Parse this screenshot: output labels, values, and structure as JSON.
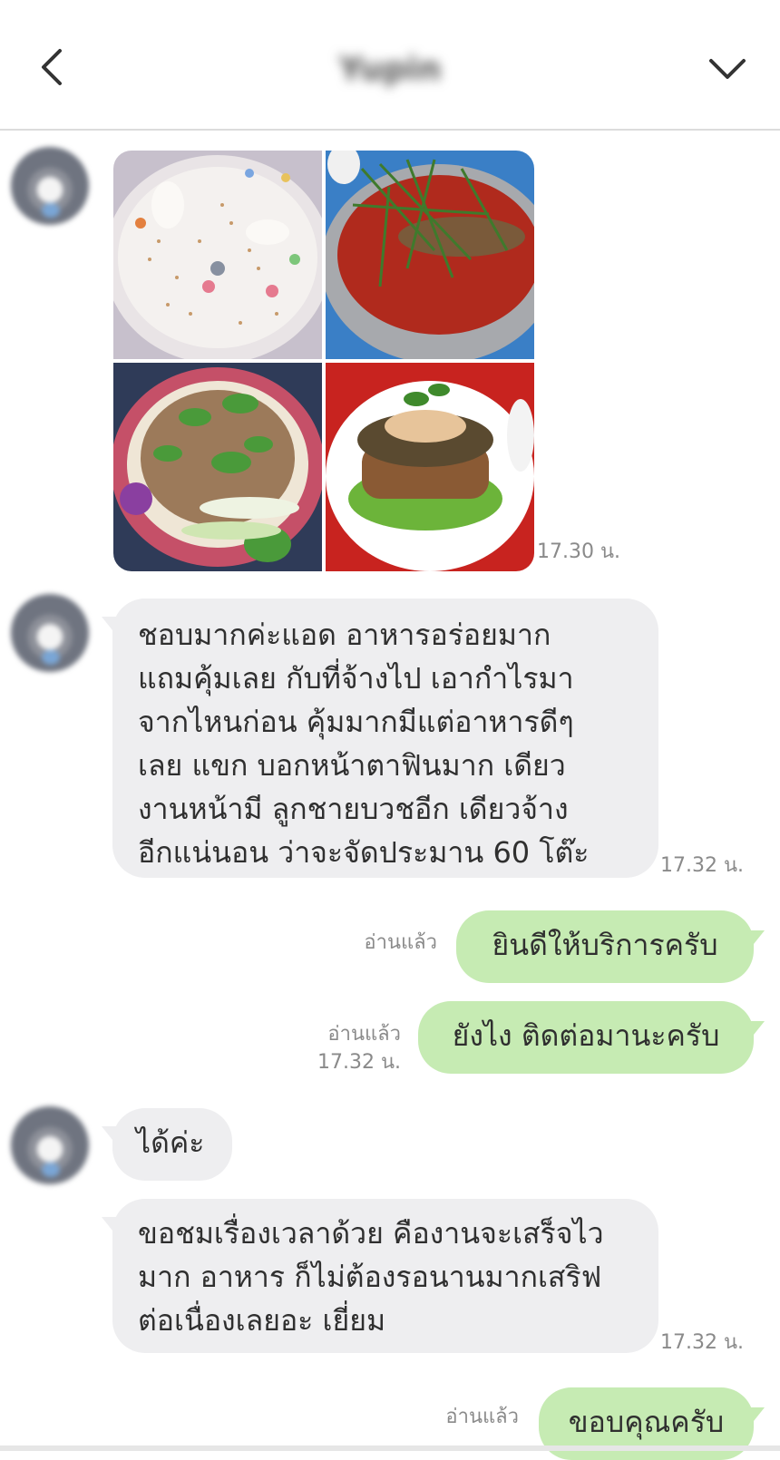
{
  "header": {
    "title": "Yupin",
    "back_icon": "chevron-left-icon",
    "menu_icon": "chevron-down-icon"
  },
  "messages": [
    {
      "type": "image-grid",
      "time": "17.30 น."
    },
    {
      "type": "text",
      "text": " ชอบมากค่ะแอด อาหารอร่อยมาก\nแถมคุ้มเลย กับที่จ้างไป เอากำไรมา\nจากไหนก่อน คุ้มมากมีแต่อาหารดีๆ\nเลย แขก บอกหน้าตาฟินมาก  เดียว\nงานหน้ามี ลูกชายบวชอีก เดียวจ้าง\nอีกแน่นอน  ว่าจะจัดประมาน 60 โต๊ะ",
      "time": "17.32 น."
    },
    {
      "type": "text",
      "text": "ยินดีให้บริการครับ",
      "read": "อ่านแล้ว"
    },
    {
      "type": "text",
      "text": "ยังไง ติดต่อมานะครับ",
      "read": "อ่านแล้ว",
      "time": "17.32 น."
    },
    {
      "type": "text",
      "text": "ได้ค่ะ"
    },
    {
      "type": "text",
      "text": "ขอชมเรื่องเวลาด้วย คืองานจะเสร็จไว\nมาก อาหาร ก็ไม่ต้องรอนานมากเสริฟ\nต่อเนื่องเลยอะ เยี่ยม",
      "time": "17.32 น."
    },
    {
      "type": "text",
      "text": "ขอบคุณครับ",
      "read": "อ่านแล้ว"
    }
  ],
  "colors": {
    "incoming_bubble": "#eeeef0",
    "outgoing_bubble": "#c6ebb3",
    "meta_text": "#8a8a8a"
  }
}
